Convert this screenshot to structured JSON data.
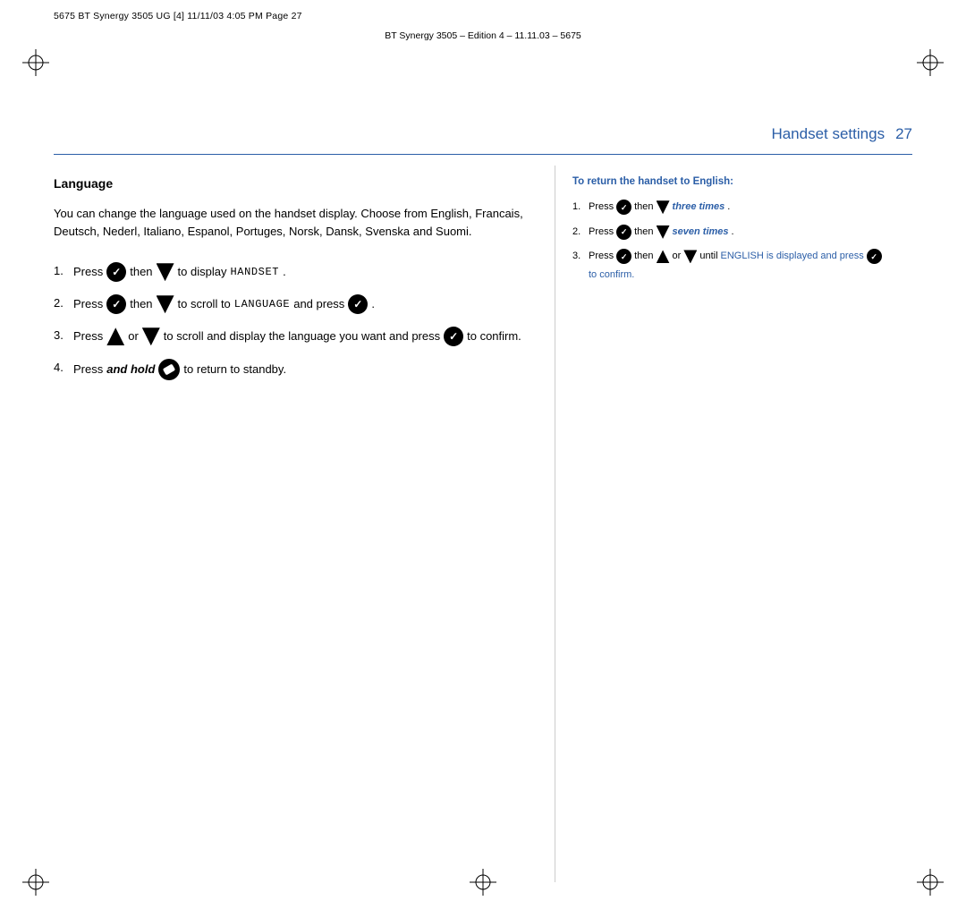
{
  "header": {
    "top_left": "5675  BT  Synergy  3505  UG  [4]    11/11/03    4:05  PM    Page  27",
    "subtitle": "BT Synergy 3505 – Edition 4 – 11.11.03 – 5675"
  },
  "page": {
    "title": "Handset settings",
    "number": "27"
  },
  "left": {
    "section_title": "Language",
    "intro": "You can change the language used on the handset display. Choose from English, Francais, Deutsch, Nederl, Italiano, Espanol, Portuges, Norsk, Dansk, Svenska and Suomi.",
    "steps": [
      {
        "number": "1.",
        "text_before": "Press",
        "has_check1": true,
        "text_mid": "then",
        "has_down1": true,
        "text_after": "to display",
        "mono": "HANDSET",
        "text_end": "."
      },
      {
        "number": "2.",
        "text_before": "Press",
        "has_check1": true,
        "text_mid": "then",
        "has_down1": true,
        "text_after": "to scroll to",
        "mono": "LANGUAGE",
        "text_after2": "and press",
        "has_check2": true,
        "text_end": "."
      },
      {
        "number": "3.",
        "text_before": "Press",
        "has_up": true,
        "text_or": "or",
        "has_down2": true,
        "text_after": "to scroll and display the language you want and press",
        "has_check2": true,
        "text_end": "to confirm."
      },
      {
        "number": "4.",
        "text_before": "Press",
        "bold_italic": "and hold",
        "has_end": true,
        "text_after": "to return to standby."
      }
    ]
  },
  "right": {
    "sidebar_title": "To return the handset to English:",
    "steps": [
      {
        "number": "1.",
        "text_before": "Press",
        "has_check": true,
        "text_mid": "then",
        "has_down": true,
        "italic_text": "three times",
        "text_end": "."
      },
      {
        "number": "2.",
        "text_before": "Press",
        "has_check": true,
        "text_mid": "then",
        "has_down": true,
        "italic_text": "seven times",
        "text_end": "."
      },
      {
        "number": "3.",
        "text_before": "Press",
        "has_check": true,
        "text_mid": "then",
        "has_up": true,
        "text_or": "or",
        "has_down2": true,
        "text_after": "until ENGLISH is displayed and press",
        "has_check2": true,
        "text_end": "to confirm."
      }
    ]
  }
}
